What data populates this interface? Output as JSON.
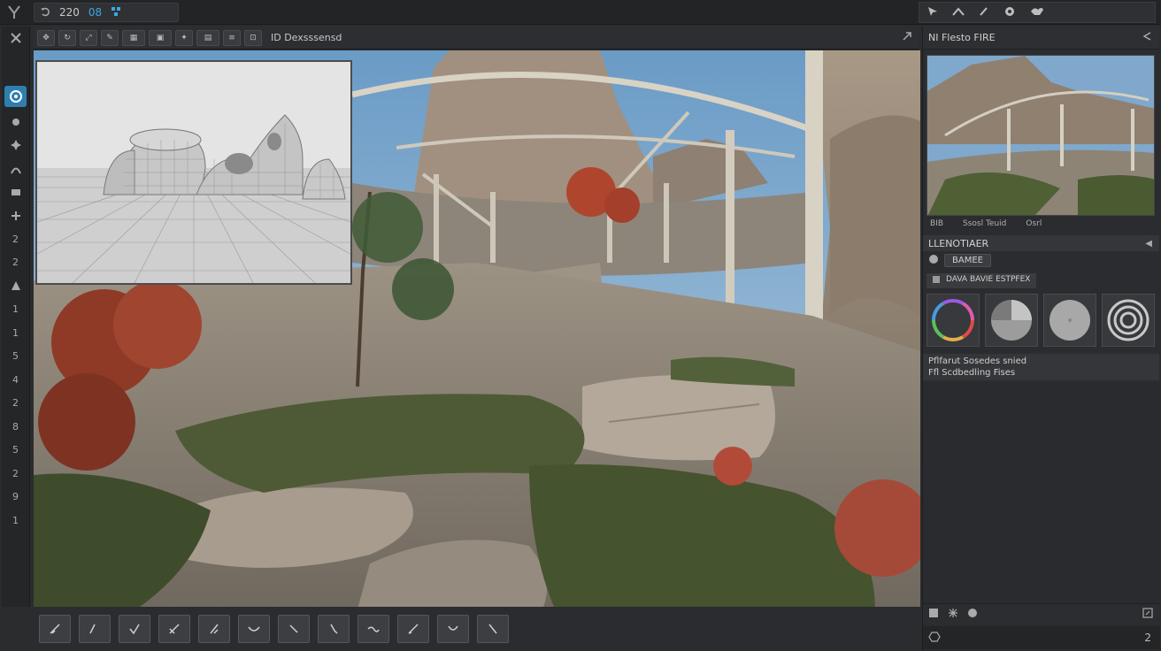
{
  "topbar": {
    "logo_icon": "logo-icon",
    "value_a": "220",
    "value_b": "08",
    "right_icons": [
      "cursor-icon",
      "arrow-up-icon",
      "pen-icon",
      "globe-icon",
      "bird-icon"
    ]
  },
  "subtoolbar": {
    "label": "ID Dexsssensd",
    "buttons": [
      "move-icon",
      "rotate-icon",
      "scale-icon",
      "brush-icon",
      "mesh-icon",
      "camera-icon",
      "light-icon",
      "grid-icon",
      "align-icon",
      "snap-icon"
    ]
  },
  "left_tools": {
    "numbers": [
      "2",
      "2",
      "1",
      "1",
      "5",
      "4",
      "2",
      "8",
      "5",
      "2",
      "9",
      "1"
    ]
  },
  "right_panel": {
    "header": "NI Flesto FIRE",
    "preview_labels": [
      "BIB",
      "Ssosl Teuid",
      "Osrl"
    ],
    "section_title": "LLENOTIAER",
    "button_label": "BAMEE",
    "row_label": "DAVA BAVIE ESTPFEX",
    "text_line1": "Pflfarut Sosedes snied",
    "text_line2": "Ffl Scdbedling Fises",
    "status_number": "2"
  },
  "colors": {
    "accent": "#2e7fb0",
    "number_blue": "#39a9e0",
    "panel_bg": "#2b2c2f"
  }
}
